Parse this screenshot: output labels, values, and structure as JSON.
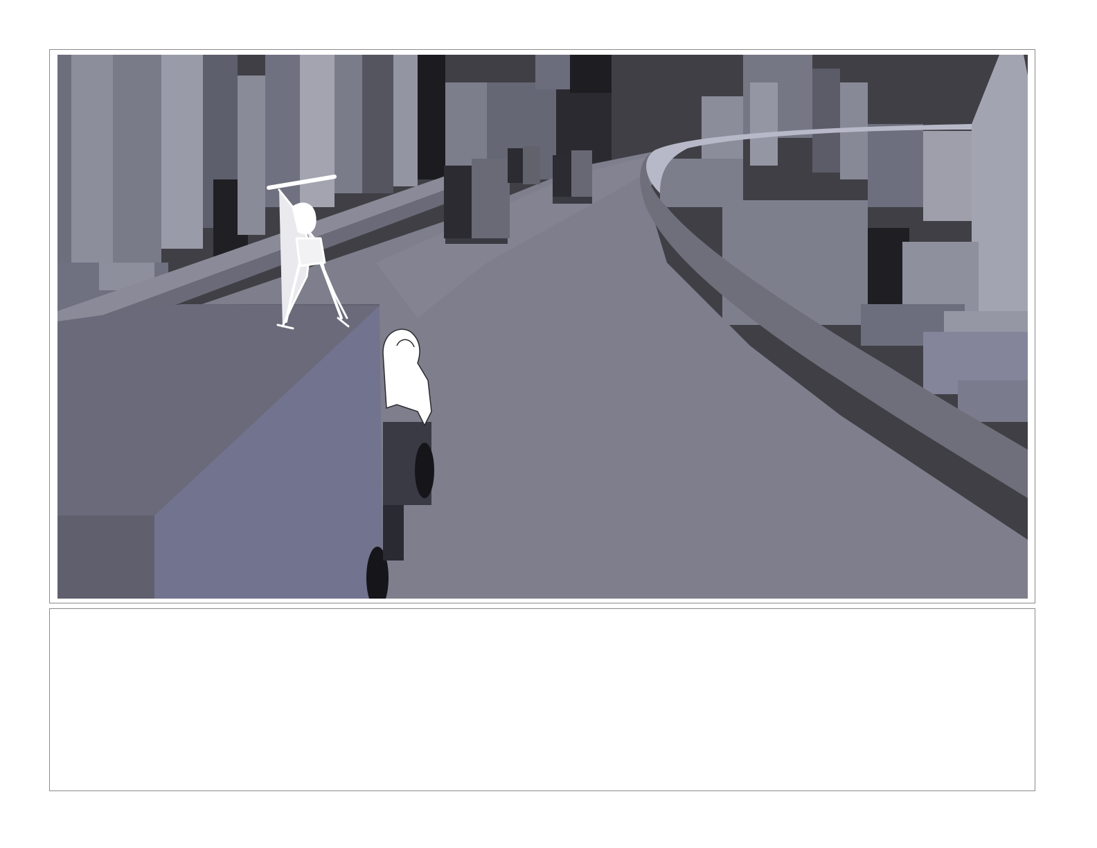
{
  "storyboard": {
    "panel": {
      "type": "storyboard-panel",
      "colors": {
        "sky": "#3f3f45",
        "building_light": "#8b8c99",
        "building_mid": "#6c6d7c",
        "building_dark": "#2a2a30",
        "road": "#7e7e8c",
        "barrier": "#6a6a74",
        "truck_top": "#66667a",
        "truck_side": "#747591",
        "sketch": "#ffffff"
      }
    },
    "notes": {
      "text": ""
    }
  }
}
